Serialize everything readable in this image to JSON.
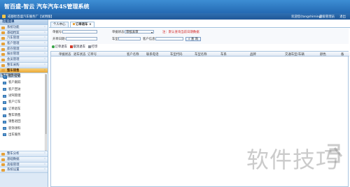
{
  "header": {
    "title": "智百盛-智云 汽车汽车4S管理系统",
    "company": "成都智百盛汽车服务厂【试用版】",
    "user": "欢迎您(tangshiming)",
    "admin_label": "超级管理员",
    "exit_label": "退出"
  },
  "sidebar": {
    "title": "功能菜单",
    "items": [
      {
        "label": "系统功能"
      },
      {
        "label": "基础档案"
      },
      {
        "label": "汽车管理"
      },
      {
        "label": "客户管理"
      },
      {
        "label": "库存管理"
      },
      {
        "label": "报价管理"
      },
      {
        "label": "会员管理"
      },
      {
        "label": "整车采购"
      },
      {
        "label": "整车销售"
      }
    ],
    "submenu": [
      {
        "label": "整车销售订单"
      },
      {
        "label": "客户登记"
      },
      {
        "label": "客户跟踪"
      },
      {
        "label": "客户回访"
      },
      {
        "label": "试驾管理"
      },
      {
        "label": "客户订车"
      },
      {
        "label": "订单退车"
      },
      {
        "label": "整车销售"
      },
      {
        "label": "销售退回"
      },
      {
        "label": "装饰领料"
      },
      {
        "label": "出车服务"
      }
    ],
    "bottom_items": [
      {
        "label": "整车分析"
      },
      {
        "label": "基础数据"
      },
      {
        "label": "高级管理"
      },
      {
        "label": "系统设置"
      }
    ]
  },
  "tabs": [
    {
      "label": "个人中心"
    },
    {
      "label": "订单退车"
    }
  ],
  "filter": {
    "order_no_label": "单据号:",
    "order_no_value": "",
    "status_label": "单据状态:",
    "status_value": "审核未审",
    "hint": "注：默认查询当前日期数据",
    "customer_label": "开单日期:",
    "date_label": "车型:",
    "date_value": "",
    "customer2_label": "客户信息:",
    "customer2_value": "",
    "search_label": "查 询"
  },
  "toolbar": {
    "add_label": "订单退车",
    "delete_label": "取消退车",
    "print_label": "打印"
  },
  "grid": {
    "columns": [
      "单据状态",
      "退车状态",
      "订单号",
      "客户名称",
      "联系电话",
      "车型代码",
      "车型名称",
      "车系",
      "品牌",
      "交通车型/车辆",
      "颜色",
      "备"
    ]
  },
  "watermark": "软件技巧",
  "colors": {
    "banner": "#2d7bc8",
    "active_menu": "#f0b84c",
    "hint": "#d21f1f"
  }
}
